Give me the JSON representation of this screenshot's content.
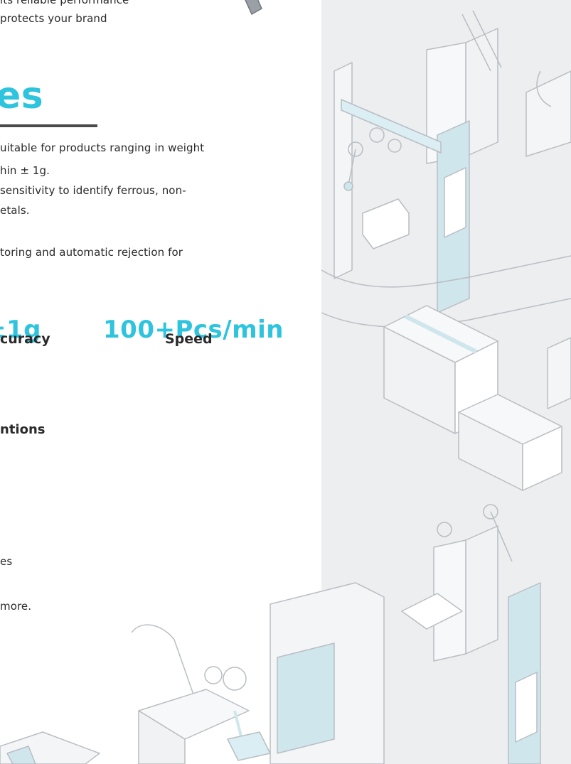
{
  "intro": {
    "line1": "its reliable performance",
    "line2": "protects your brand"
  },
  "features": {
    "heading": "es",
    "bullets": [
      "uitable for products ranging in weight",
      "hin ± 1g.",
      " sensitivity to identify ferrous, non-",
      "etals.",
      "toring and automatic rejection for"
    ]
  },
  "stats": [
    {
      "value": "±1g",
      "label": "curacy"
    },
    {
      "value": "100+Pcs/min",
      "label": "Speed"
    }
  ],
  "applications": {
    "heading": "ntions",
    "lines": [
      "es",
      "more."
    ]
  },
  "colors": {
    "accent": "#2ec4dd",
    "panel_bg": "#eceef0",
    "line_art": "#b9bec3",
    "tint": "#cfe6ec"
  }
}
